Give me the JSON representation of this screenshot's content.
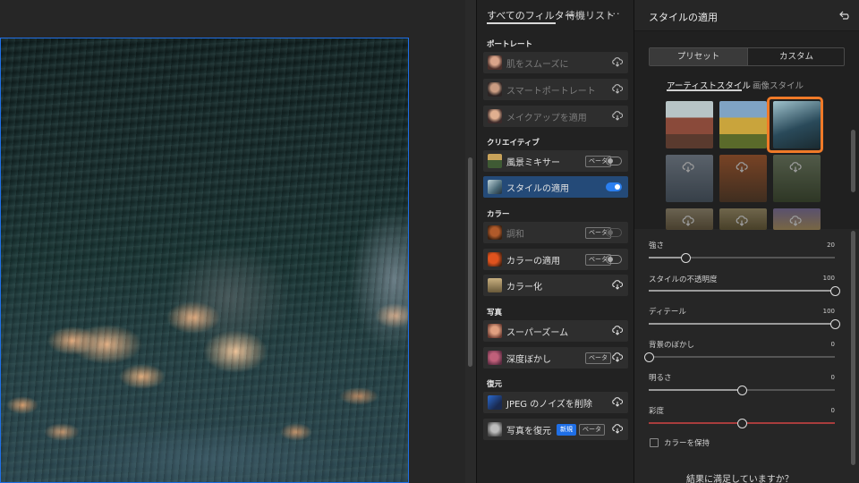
{
  "filters_panel": {
    "tabs": [
      {
        "label": "すべてのフィルター",
        "active": true
      },
      {
        "label": "待機リスト",
        "active": false
      }
    ],
    "more_label": "···",
    "sections": [
      {
        "title": "ポートレート",
        "items": [
          {
            "label": "肌をスムーズに",
            "state": "download",
            "dim": true
          },
          {
            "label": "スマートポートレート",
            "state": "download",
            "dim": true
          },
          {
            "label": "メイクアップを適用",
            "state": "download",
            "dim": true
          }
        ]
      },
      {
        "title": "クリエイティブ",
        "items": [
          {
            "label": "風景ミキサー",
            "badge": "ベータ",
            "state": "toggle-off"
          },
          {
            "label": "スタイルの適用",
            "state": "toggle-on",
            "active": true
          }
        ]
      },
      {
        "title": "カラー",
        "items": [
          {
            "label": "調和",
            "badge": "ベータ",
            "state": "toggle-disabled",
            "dim": true
          },
          {
            "label": "カラーの適用",
            "badge": "ベータ",
            "state": "toggle-off"
          },
          {
            "label": "カラー化",
            "state": "download"
          }
        ]
      },
      {
        "title": "写真",
        "items": [
          {
            "label": "スーパーズーム",
            "state": "download"
          },
          {
            "label": "深度ぼかし",
            "badge": "ベータ",
            "state": "download"
          }
        ]
      },
      {
        "title": "復元",
        "items": [
          {
            "label": "JPEG のノイズを削除",
            "state": "download"
          },
          {
            "label": "写真を復元",
            "badge_new": "新規",
            "badge": "ベータ",
            "state": "download"
          }
        ]
      }
    ]
  },
  "style_panel": {
    "title": "スタイルの適用",
    "segments": {
      "preset": "プリセット",
      "custom": "カスタム"
    },
    "subtabs": {
      "artist": "アーティストスタイル",
      "image": "画像スタイル"
    },
    "sliders": [
      {
        "label": "強さ",
        "value": "20",
        "fraction": 0.2,
        "accent": false
      },
      {
        "label": "スタイルの不透明度",
        "value": "100",
        "fraction": 1.0,
        "accent": false
      },
      {
        "label": "ディテール",
        "value": "100",
        "fraction": 1.0,
        "accent": false
      },
      {
        "label": "背景のぼかし",
        "value": "0",
        "fraction": 0.0,
        "accent": false
      },
      {
        "label": "明るさ",
        "value": "0",
        "fraction": 0.5,
        "accent": false
      },
      {
        "label": "彩度",
        "value": "0",
        "fraction": 0.5,
        "accent": true
      }
    ],
    "keep_color_label": "カラーを保持",
    "footer_question": "結果に満足していますか？"
  },
  "colors": {
    "selection_blue": "#1f6fe6",
    "active_row": "#244a78",
    "thumbnail_highlight": "#f07a28",
    "saturation_track": "#a83c3c"
  }
}
